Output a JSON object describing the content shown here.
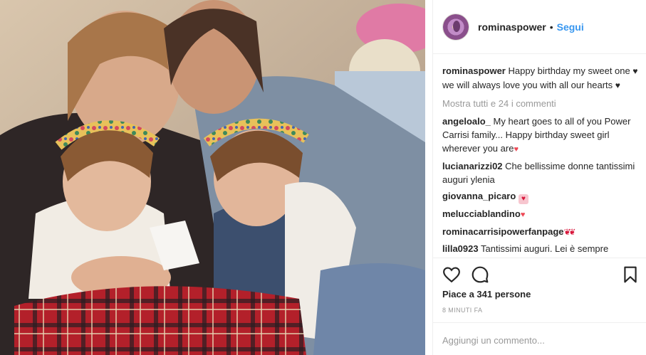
{
  "post": {
    "photo_alt": "Vintage family photo"
  },
  "header": {
    "username": "rominaspower",
    "separator": "•",
    "follow_label": "Segui"
  },
  "caption": {
    "username": "rominaspower",
    "text_part1": "Happy birthday my sweet one",
    "text_part2": "we will always love you with all our hearts",
    "heart": "♥"
  },
  "view_all_comments": "Mostra tutti e 24 i commenti",
  "comments": [
    {
      "user": "angeloalo_",
      "text": "My heart goes to all of you Power Carrisi family... Happy birthday sweet girl wherever you are",
      "emoji": "♥"
    },
    {
      "user": "lucianarizzi02",
      "text": "Che bellissime donne tantissimi auguri ylenia",
      "emoji": ""
    },
    {
      "user": "giovanna_picaro",
      "text": "",
      "emoji": "♥"
    },
    {
      "user": "melucciablandino",
      "text": "",
      "emoji": "♥"
    },
    {
      "user": "rominacarrisipowerfanpage",
      "text": "",
      "emoji": "❦❦"
    },
    {
      "user": "lilla0923",
      "text": "Tantissimi auguri. Lei è sempre",
      "emoji": ""
    }
  ],
  "actions": {
    "like_icon": "heart-outline",
    "comment_icon": "speech-bubble",
    "save_icon": "bookmark"
  },
  "likes_text": "Piace a 341 persone",
  "timestamp": "8 MINUTI FA",
  "comment_input": {
    "placeholder": "Aggiungi un commento..."
  },
  "colors": {
    "link_blue": "#3897f0",
    "muted_gray": "#999999",
    "text": "#262626",
    "heart_red": "#ed4956"
  }
}
